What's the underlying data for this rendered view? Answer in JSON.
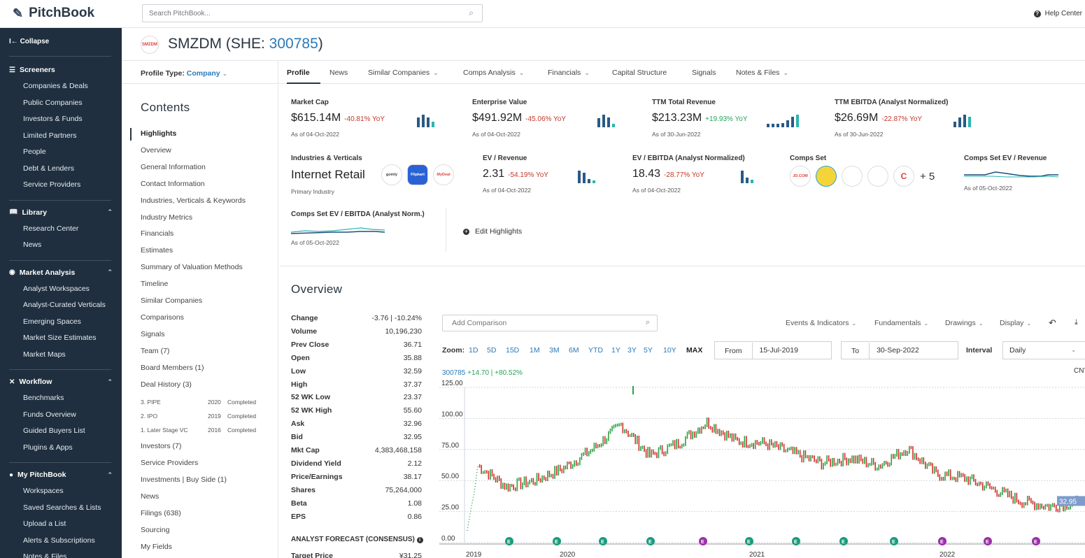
{
  "app": {
    "name": "PitchBook",
    "search_placeholder": "Search PitchBook...",
    "help": "Help Center"
  },
  "sidebar": {
    "collapse": "Collapse",
    "sections": [
      {
        "title": "Screeners",
        "icon": "list-icon",
        "items": [
          "Companies & Deals",
          "Public Companies",
          "Investors & Funds",
          "Limited Partners",
          "People",
          "Debt & Lenders",
          "Service Providers"
        ]
      },
      {
        "title": "Library",
        "icon": "book-icon",
        "items": [
          "Research Center",
          "News"
        ]
      },
      {
        "title": "Market Analysis",
        "icon": "globe-icon",
        "items": [
          "Analyst Workspaces",
          "Analyst-Curated Verticals",
          "Emerging Spaces",
          "Market Size Estimates",
          "Market Maps"
        ]
      },
      {
        "title": "Workflow",
        "icon": "tools-icon",
        "items": [
          "Benchmarks",
          "Funds Overview",
          "Guided Buyers List",
          "Plugins & Apps"
        ]
      },
      {
        "title": "My PitchBook",
        "icon": "user-icon",
        "items": [
          "Workspaces",
          "Saved Searches & Lists",
          "Upload a List",
          "Alerts & Subscriptions",
          "Notes & Files"
        ]
      }
    ]
  },
  "company": {
    "logo_text": "SMZDM",
    "name": "SMZDM (SHE: ",
    "ticker": "300785",
    "close": ")"
  },
  "profile_type": {
    "label": "Profile Type:",
    "value": "Company"
  },
  "tabs": [
    {
      "label": "Profile",
      "dd": false
    },
    {
      "label": "News",
      "dd": false
    },
    {
      "label": "Similar Companies",
      "dd": true
    },
    {
      "label": "Comps Analysis",
      "dd": true
    },
    {
      "label": "Financials",
      "dd": true
    },
    {
      "label": "Capital Structure",
      "dd": false
    },
    {
      "label": "Signals",
      "dd": false
    },
    {
      "label": "Notes & Files",
      "dd": true
    }
  ],
  "contents": {
    "title": "Contents",
    "items": [
      "Highlights",
      "Overview",
      "General Information",
      "Contact Information",
      "Industries, Verticals & Keywords",
      "Industry Metrics",
      "Financials",
      "Estimates",
      "Summary of Valuation Methods",
      "Timeline",
      "Similar Companies",
      "Comparisons",
      "Signals",
      "Team (7)",
      "Board Members (1)",
      "Deal History (3)"
    ],
    "deals": [
      {
        "name": "3. PIPE",
        "year": "2020",
        "status": "Completed"
      },
      {
        "name": "2. IPO",
        "year": "2019",
        "status": "Completed"
      },
      {
        "name": "1. Later Stage VC",
        "year": "2016",
        "status": "Completed"
      }
    ],
    "items_after": [
      "Investors (7)",
      "Service Providers",
      "Investments | Buy Side (1)",
      "News",
      "Filings (638)",
      "Sourcing",
      "My Fields"
    ]
  },
  "highlights": {
    "market_cap": {
      "label": "Market Cap",
      "value": "$615.14M",
      "change": "-40.81% YoY",
      "asof": "As of 04-Oct-2022",
      "bars": [
        0.8,
        1.0,
        0.75,
        0.45
      ]
    },
    "ev": {
      "label": "Enterprise Value",
      "value": "$491.92M",
      "change": "-45.06% YoY",
      "asof": "As of 04-Oct-2022",
      "bars": [
        0.7,
        1.0,
        0.75,
        0.3
      ]
    },
    "revenue": {
      "label": "TTM Total Revenue",
      "value": "$213.23M",
      "change": "+19.93% YoY",
      "asof": "As of 30-Jun-2022",
      "bars": [
        0.25,
        0.25,
        0.3,
        0.35,
        0.55,
        0.85,
        1.0
      ]
    },
    "ebitda": {
      "label": "TTM EBITDA (Analyst Normalized)",
      "value": "$26.69M",
      "change": "-22.87% YoY",
      "asof": "As of 30-Jun-2022",
      "bars": [
        0.45,
        0.75,
        1.0,
        0.85
      ]
    },
    "industries": {
      "label": "Industries & Verticals",
      "value": "Internet Retail",
      "asof": "Primary Industry",
      "logos": [
        "gomly",
        "Flipkart",
        "MyDeal"
      ]
    },
    "ev_rev": {
      "label": "EV / Revenue",
      "value": "2.31",
      "change": "-54.19% YoY",
      "asof": "As of 04-Oct-2022",
      "bars": [
        1.0,
        0.85,
        0.35,
        0.2
      ]
    },
    "ev_ebitda": {
      "label": "EV / EBITDA (Analyst Normalized)",
      "value": "18.43",
      "change": "-28.77% YoY",
      "asof": "As of 04-Oct-2022",
      "bars": [
        1.0,
        0.45,
        0.25
      ]
    },
    "comps_set": {
      "label": "Comps Set",
      "logos": [
        "JD.COM",
        "",
        "",
        "",
        "C"
      ],
      "more": "+ 5"
    },
    "comps_ev_rev": {
      "label": "Comps Set EV / Revenue",
      "asof": "As of 05-Oct-2022"
    },
    "comps_ev_ebitda": {
      "label": "Comps Set EV / EBITDA (Analyst Norm.)",
      "asof": "As of 05-Oct-2022"
    },
    "edit": "Edit Highlights"
  },
  "overview": {
    "title": "Overview",
    "stats": [
      [
        "Change",
        "-3.76 | -10.24%"
      ],
      [
        "Volume",
        "10,196,230"
      ],
      [
        "Prev Close",
        "36.71"
      ],
      [
        "Open",
        "35.88"
      ],
      [
        "Low",
        "32.59"
      ],
      [
        "High",
        "37.37"
      ],
      [
        "52 WK Low",
        "23.37"
      ],
      [
        "52 WK High",
        "55.60"
      ],
      [
        "Ask",
        "32.96"
      ],
      [
        "Bid",
        "32.95"
      ],
      [
        "Mkt Cap",
        "4,383,468,158"
      ],
      [
        "Dividend Yield",
        "2.12"
      ],
      [
        "Price/Earnings",
        "38.17"
      ],
      [
        "Shares",
        "75,264,000"
      ],
      [
        "Beta",
        "1.08"
      ],
      [
        "EPS",
        "0.86"
      ]
    ],
    "forecast_title": "ANALYST FORECAST (CONSENSUS)",
    "target_price": {
      "label": "Target Price",
      "value": "¥31.25"
    }
  },
  "chart_controls": {
    "compare_placeholder": "Add Comparison",
    "dropdowns": [
      "Events & Indicators",
      "Fundamentals",
      "Drawings",
      "Display"
    ],
    "zoom_label": "Zoom:",
    "zooms": [
      "1D",
      "5D",
      "15D",
      "1M",
      "3M",
      "6M",
      "YTD",
      "1Y",
      "3Y",
      "5Y",
      "10Y",
      "MAX"
    ],
    "from_label": "From",
    "from": "15-Jul-2019",
    "to_label": "To",
    "to": "30-Sep-2022",
    "interval_label": "Interval",
    "interval": "Daily",
    "ticker": "300785",
    "change": "+14.70 | +80.52%",
    "currency": "CNY"
  },
  "chart_data": {
    "type": "line",
    "title": "",
    "ylabels": [
      "125.00",
      "100.00",
      "75.00",
      "50.00",
      "25.00",
      "0.00"
    ],
    "ylim": [
      0,
      125
    ],
    "xlabels": [
      "2019",
      "2020",
      "2021",
      "2022"
    ],
    "last_price_label": "32.95",
    "x": [
      "2019-07",
      "2019-08",
      "2019-10",
      "2019-12",
      "2020-02",
      "2020-03",
      "2020-05",
      "2020-07",
      "2020-08",
      "2020-10",
      "2020-12",
      "2021-02",
      "2021-04",
      "2021-06",
      "2021-08",
      "2021-10",
      "2021-12",
      "2022-02",
      "2022-04",
      "2022-06",
      "2022-08",
      "2022-09"
    ],
    "series": [
      {
        "values": [
          62,
          45,
          50,
          60,
          75,
          95,
          70,
          80,
          97,
          82,
          80,
          72,
          64,
          68,
          62,
          76,
          55,
          52,
          43,
          33,
          29,
          33
        ]
      }
    ],
    "event_markers": [
      "E",
      "E",
      "E",
      "E",
      "E",
      "E",
      "E",
      "E",
      "E",
      "E",
      "E",
      "E"
    ],
    "event_colors": [
      "#1a9b7e",
      "#1a9b7e",
      "#1a9b7e",
      "#1a9b7e",
      "#9b2fa8",
      "#1a9b7e",
      "#1a9b7e",
      "#1a9b7e",
      "#1a9b7e",
      "#9b2fa8",
      "#9b2fa8",
      "#9b2fa8"
    ]
  }
}
